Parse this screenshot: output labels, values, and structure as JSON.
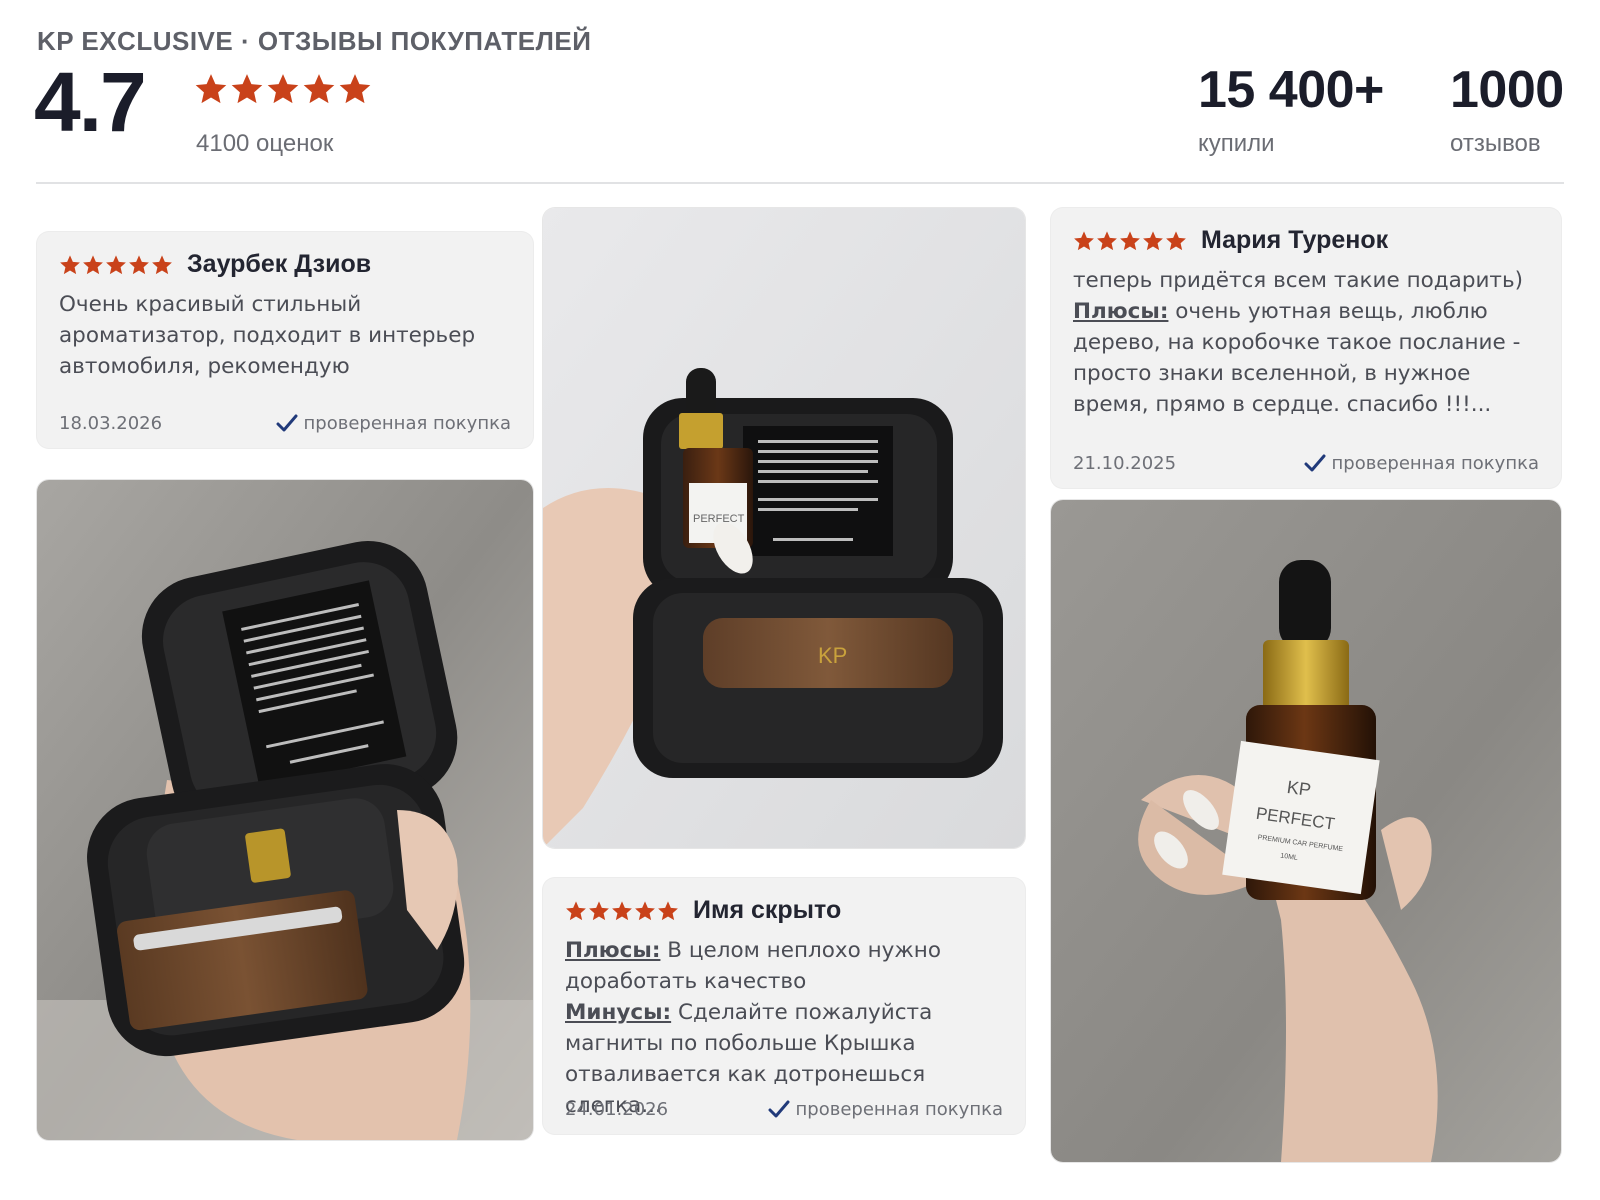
{
  "header": {
    "brand_line": "KP EXCLUSIVE · ОТЗЫВЫ ПОКУПАТЕЛЕЙ",
    "rating": "4.7",
    "rating_count": "4100 оценок",
    "stars": 5,
    "stats": [
      {
        "value": "15 400+",
        "label": "купили"
      },
      {
        "value": "1000",
        "label": "отзывов"
      }
    ]
  },
  "colors": {
    "star": "#c9421a",
    "check": "#213a7a",
    "card_bg": "#f2f2f2"
  },
  "reviews": [
    {
      "author": "Заурбек Дзиов",
      "stars": 5,
      "text": "Очень красивый стильный ароматизатор, подходит в интерьер автомобиля, рекомендую",
      "date": "18.03.2026",
      "verified": "проверенная покупка"
    },
    {
      "author": "Мария Туренок",
      "stars": 5,
      "text_before": "теперь придётся всем такие подарить)",
      "pros_label": "Плюсы:",
      "pros_text": " очень уютная вещь, люблю дерево, на коробочке такое послание - просто знаки вселенной, в нужное время, прямо в сердце. спасибо !!!...",
      "date": "21.10.2025",
      "verified": "проверенная покупка"
    },
    {
      "author": "Имя скрыто",
      "stars": 5,
      "pros_label": "Плюсы:",
      "pros_text": " В целом неплохо нужно доработать качество",
      "cons_label": "Минусы:",
      "cons_text": " Сделайте пожалуйста магниты по побольше Крышка отваливается как дотронешься слегка...",
      "date": "24.01.2026",
      "verified": "проверенная покупка"
    }
  ],
  "photos": [
    {
      "alt": "photo-open-case-with-wood-diffuser",
      "bottle_label": ""
    },
    {
      "alt": "photo-hand-holding-open-case-with-bottle",
      "bottle_label": "PERFECT"
    },
    {
      "alt": "photo-hand-holding-perfume-bottle",
      "bottle_label": "PERFECT",
      "bottle_sub": "PREMIUM CAR PERFUME",
      "bottle_vol": "10ML",
      "logo": "KP"
    }
  ]
}
